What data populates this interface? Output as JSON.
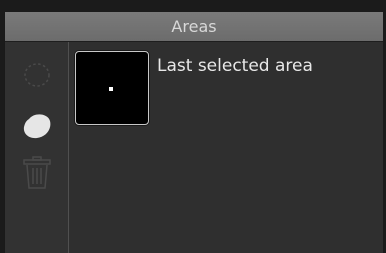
{
  "panel": {
    "title": "Areas"
  },
  "toolbar": {
    "tools": [
      {
        "name": "lasso-select-icon",
        "state": "disabled"
      },
      {
        "name": "area-blob-icon",
        "state": "enabled"
      },
      {
        "name": "trash-icon",
        "state": "disabled"
      }
    ]
  },
  "areas": {
    "items": [
      {
        "label": "Last selected area"
      }
    ]
  },
  "colors": {
    "title_bar": "#737373",
    "panel_bg": "#2f2f2f",
    "text": "#e8e8e8",
    "icon_enabled": "#e6e6e6",
    "icon_disabled": "#4a4a4a"
  }
}
